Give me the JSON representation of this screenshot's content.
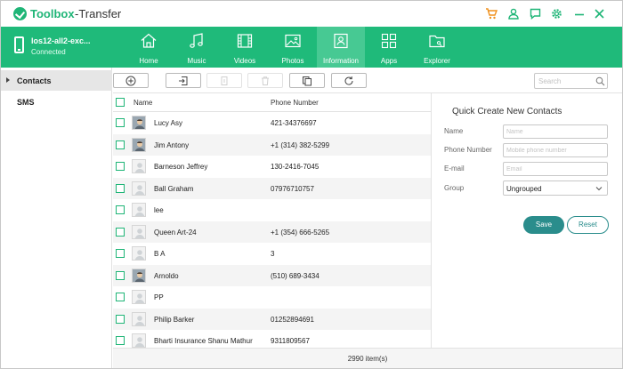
{
  "app": {
    "brand": "Toolbox",
    "suffix": "-Transfer"
  },
  "device": {
    "name": "los12-all2-exc...",
    "status": "Connected"
  },
  "nav": {
    "tabs": [
      {
        "label": "Home",
        "icon": "home-icon"
      },
      {
        "label": "Music",
        "icon": "music-icon"
      },
      {
        "label": "Videos",
        "icon": "film-icon"
      },
      {
        "label": "Photos",
        "icon": "image-icon"
      },
      {
        "label": "Information",
        "icon": "contact-card-icon",
        "active": true
      },
      {
        "label": "Apps",
        "icon": "apps-grid-icon"
      },
      {
        "label": "Explorer",
        "icon": "folder-icon"
      }
    ]
  },
  "sidebar": {
    "items": [
      {
        "label": "Contacts",
        "active": true
      },
      {
        "label": "SMS"
      }
    ]
  },
  "toolbar": {
    "buttons": [
      "add-icon",
      "import-icon",
      "export-icon",
      "delete-icon",
      "duplicate-icon",
      "refresh-icon"
    ],
    "search_placeholder": "Search"
  },
  "table": {
    "columns": [
      "Name",
      "Phone Number"
    ],
    "rows": [
      {
        "name": "Lucy  Asy",
        "phone": "421-34376697",
        "avatar": "photo"
      },
      {
        "name": "Jim  Antony",
        "phone": "+1 (314) 382-5299",
        "avatar": "photo"
      },
      {
        "name": "Barneson Jeffrey",
        "phone": "130-2416-7045",
        "avatar": "placeholder"
      },
      {
        "name": "Ball Graham",
        "phone": "07976710757",
        "avatar": "placeholder"
      },
      {
        "name": "lee",
        "phone": "",
        "avatar": "placeholder"
      },
      {
        "name": "Queen  Art-24",
        "phone": "+1 (354) 666-5265",
        "avatar": "placeholder"
      },
      {
        "name": "B A",
        "phone": "3",
        "avatar": "placeholder"
      },
      {
        "name": "Arnoldo",
        "phone": "(510) 689-3434",
        "avatar": "photo"
      },
      {
        "name": "PP",
        "phone": "",
        "avatar": "placeholder"
      },
      {
        "name": "Philip  Barker",
        "phone": "01252894691",
        "avatar": "placeholder"
      },
      {
        "name": "Bharti Insurance Shanu Mathur",
        "phone": "9311809567",
        "avatar": "placeholder"
      }
    ]
  },
  "quick_create": {
    "title": "Quick Create New Contacts",
    "fields": [
      {
        "label": "Name",
        "placeholder": "Name"
      },
      {
        "label": "Phone Number",
        "placeholder": "Mobile phone number"
      },
      {
        "label": "E-mail",
        "placeholder": "Email"
      }
    ],
    "group_label": "Group",
    "group_value": "Ungrouped",
    "save_label": "Save",
    "reset_label": "Reset"
  },
  "footer": {
    "count": "2990  item(s)"
  },
  "colors": {
    "brand_green": "#1fba7a",
    "active_tab": "#47c993",
    "button_teal": "#2a8d8c",
    "cart_orange": "#f0901c"
  }
}
